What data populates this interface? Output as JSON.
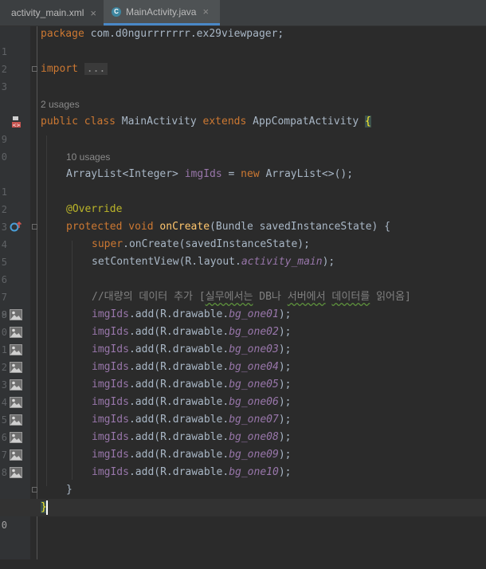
{
  "tabs": [
    {
      "label": "activity_main.xml",
      "close": "×"
    },
    {
      "label": "MainActivity.java",
      "icon": "C",
      "close": "×"
    }
  ],
  "line_numbers": [
    "1",
    "2",
    "3",
    "",
    "9",
    "0",
    "1",
    "2",
    "3",
    "4",
    "5",
    "6",
    "7",
    "8",
    "9",
    "0",
    "1",
    "2",
    "3",
    "4",
    "5",
    "6",
    "7",
    "8",
    "",
    "0"
  ],
  "code": {
    "package_kw": "package",
    "package_name": " com.d0ngurrrrrrr.ex29viewpager;",
    "import_kw": "import",
    "import_fold": "...",
    "usages_class": "2 usages",
    "public_kw": "public",
    "class_kw": "class",
    "class_name": "MainActivity",
    "extends_kw": "extends",
    "super_class": "AppCompatActivity",
    "open_brace": "{",
    "usages_field": "10 usages",
    "field_type": "ArrayList<Integer> ",
    "field_name": "imgIds",
    "assign": " = ",
    "new_kw": "new",
    "new_expr": " ArrayList<>();",
    "override": "@Override",
    "protected_kw": "protected",
    "void_kw": "void",
    "method_name": "onCreate",
    "params": "(Bundle savedInstanceState) {",
    "super_kw": "super",
    "super_call": ".onCreate(savedInstanceState);",
    "set_content": "setContentView(R.layout.",
    "layout_name": "activity_main",
    "set_content_end": ");",
    "comment_a": "//대량의 데이터 추가 [",
    "comment_b": "실무에서는",
    "comment_c": " DB나 ",
    "comment_d": "서버에서",
    "comment_e": " ",
    "comment_f": "데이터를",
    "comment_g": " 읽어옴]",
    "add_prefix": ".add(R.drawable.",
    "add_suffix": ");",
    "drawables": [
      "bg_one01",
      "bg_one02",
      "bg_one03",
      "bg_one04",
      "bg_one05",
      "bg_one06",
      "bg_one07",
      "bg_one08",
      "bg_one09",
      "bg_one10"
    ],
    "close_method": "}",
    "close_class": "}"
  },
  "colors": {
    "background": "#2b2b2b",
    "keyword": "#cc7832",
    "field": "#9876aa",
    "method": "#ffc66d",
    "annotation": "#bbb529",
    "comment": "#808080"
  },
  "icons": {
    "override_marker": "override-gutter-icon",
    "class_marker": "implemented-gutter-icon",
    "image_marker": "image-gutter-icon"
  }
}
